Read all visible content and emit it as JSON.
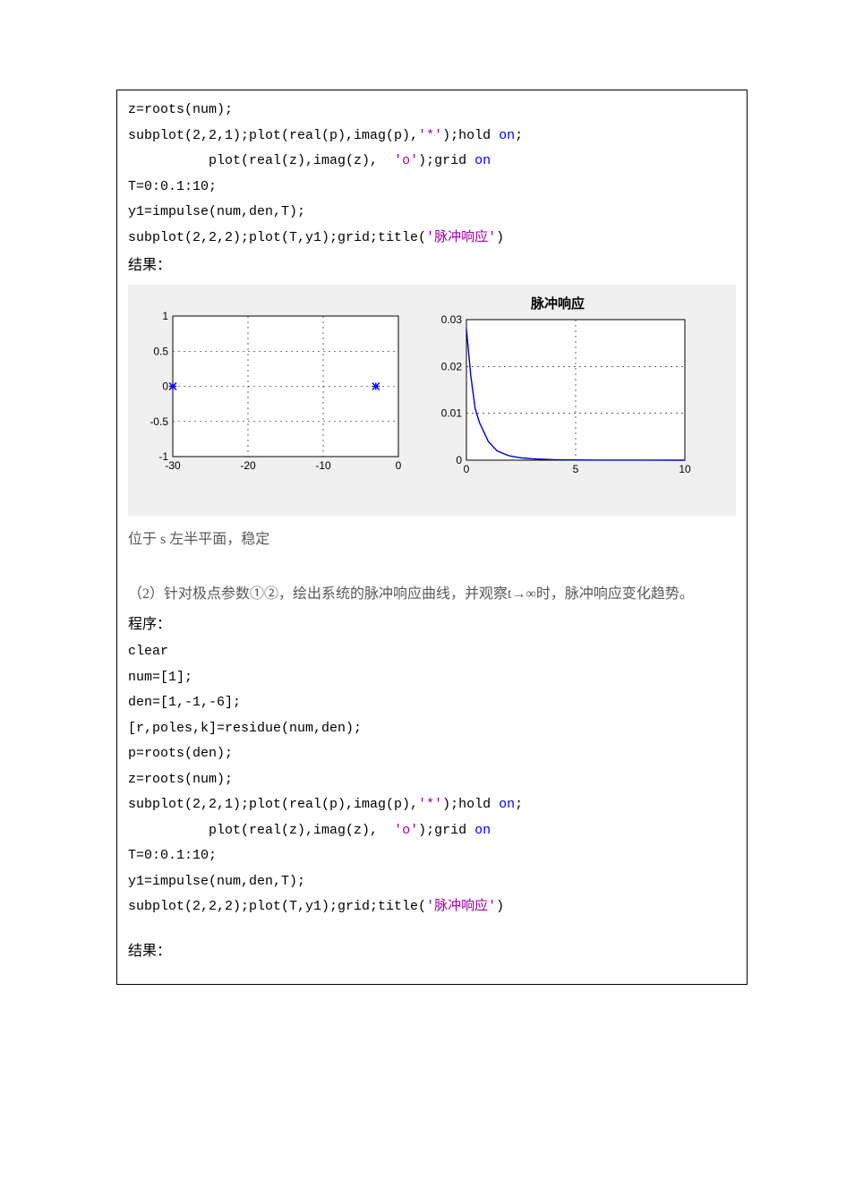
{
  "code_block_1": {
    "l1a": "z=roots(num);",
    "l2a": "subplot(2,2,1);plot(real(p),imag(p),",
    "l2s": "'*'",
    "l2b": ");hold ",
    "l2kw": "on",
    "l2c": ";",
    "l3a": "          plot(real(z),imag(z),  ",
    "l3s": "'o'",
    "l3b": ");grid ",
    "l3kw": "on",
    "l4a": "T=0:0.1:10;",
    "l5a": "y1=impulse(num,den,T);",
    "l6a": "subplot(2,2,2);plot(T,y1);grid;title(",
    "l6s": "'脉冲响应'",
    "l6b": ")"
  },
  "result_label": "结果：",
  "caption_stable": "位于 s 左半平面，稳定",
  "question2": "（2）针对极点参数①②，绘出系统的脉冲响应曲线，并观察t→∞时，脉冲响应变化趋势。",
  "program_label": "程序：",
  "code_block_2": {
    "l1": "clear",
    "l2": "num=[1];",
    "l3": "den=[1,-1,-6];",
    "l4": "[r,poles,k]=residue(num,den);",
    "l5": "p=roots(den);",
    "l6": "z=roots(num);",
    "l7a": "subplot(2,2,1);plot(real(p),imag(p),",
    "l7s": "'*'",
    "l7b": ");hold ",
    "l7kw": "on",
    "l7c": ";",
    "l8a": "          plot(real(z),imag(z),  ",
    "l8s": "'o'",
    "l8b": ");grid ",
    "l8kw": "on",
    "l9": "T=0:0.1:10;",
    "l10": "y1=impulse(num,den,T);",
    "l11a": "subplot(2,2,2);plot(T,y1);grid;title(",
    "l11s": "'脉冲响应'",
    "l11b": ")"
  },
  "result_label2": "结果：",
  "chart_data": [
    {
      "type": "scatter",
      "title": "",
      "xlim": [
        -30,
        0
      ],
      "ylim": [
        -1,
        1
      ],
      "xticks": [
        -30,
        -20,
        -10,
        0
      ],
      "yticks": [
        -1,
        -0.5,
        0,
        0.5,
        1
      ],
      "poles": [
        {
          "x": -30,
          "y": 0
        },
        {
          "x": -3,
          "y": 0
        }
      ],
      "zeros": []
    },
    {
      "type": "line",
      "title": "脉冲响应",
      "xlim": [
        0,
        10
      ],
      "ylim": [
        0,
        0.03
      ],
      "xticks": [
        0,
        5,
        10
      ],
      "yticks": [
        0,
        0.01,
        0.02,
        0.03
      ],
      "x": [
        0,
        0.2,
        0.4,
        0.6,
        0.8,
        1.0,
        1.2,
        1.4,
        1.6,
        1.8,
        2.0,
        2.5,
        3.0,
        4.0,
        5.0,
        6.0,
        8.0,
        10.0
      ],
      "y": [
        0.028,
        0.018,
        0.011,
        0.008,
        0.006,
        0.004,
        0.003,
        0.002,
        0.0016,
        0.0012,
        0.0009,
        0.0005,
        0.0003,
        0.0001,
        5e-05,
        2e-05,
        5e-06,
        1e-06
      ]
    }
  ]
}
